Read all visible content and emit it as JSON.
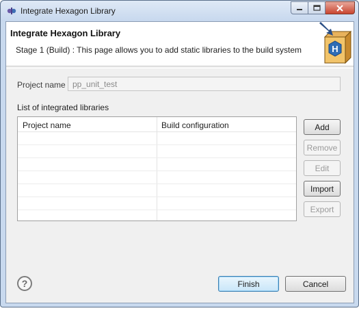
{
  "window": {
    "title": "Integrate Hexagon Library",
    "icons": {
      "app": "eclipse-plugin-icon",
      "minimize": "minimize-icon",
      "maximize": "maximize-icon",
      "close": "close-icon"
    }
  },
  "banner": {
    "title": "Integrate Hexagon Library",
    "description": "Stage 1 (Build) : This page allows you to add static libraries to the build system",
    "image_icon": "hexagon-box-icon",
    "image_letter": "H"
  },
  "project": {
    "label": "Project name",
    "value": "pp_unit_test"
  },
  "libraries": {
    "label": "List of integrated libraries",
    "columns": [
      "Project name",
      "Build configuration"
    ],
    "rows": []
  },
  "side_buttons": {
    "add": "Add",
    "remove": "Remove",
    "edit": "Edit",
    "import": "Import",
    "export": "Export"
  },
  "footer": {
    "help_icon": "help-icon",
    "help_glyph": "?",
    "finish": "Finish",
    "cancel": "Cancel"
  },
  "colors": {
    "frame": "#c8d9ee",
    "close_button": "#c9452f",
    "default_button_border": "#3c7fb1"
  }
}
